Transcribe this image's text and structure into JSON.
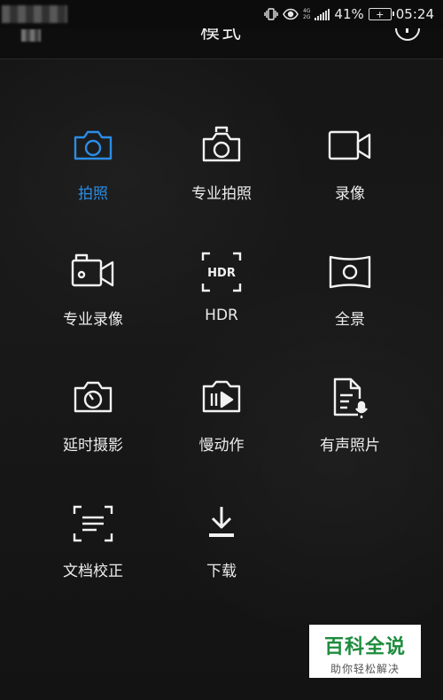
{
  "status_bar": {
    "network_top": "4G",
    "network_bottom": "2G",
    "battery_percent": "41%",
    "time": "05:24",
    "icons": [
      "vibrate-icon",
      "eye-icon",
      "signal-icon",
      "battery-charging-icon"
    ]
  },
  "header": {
    "title": "模式",
    "back_icon": "back-icon",
    "info_icon": "info-icon"
  },
  "modes": [
    {
      "label": "拍照",
      "icon": "camera-icon",
      "active": true
    },
    {
      "label": "专业拍照",
      "icon": "pro-camera-icon",
      "active": false
    },
    {
      "label": "录像",
      "icon": "video-icon",
      "active": false
    },
    {
      "label": "专业录像",
      "icon": "pro-video-icon",
      "active": false
    },
    {
      "label": "HDR",
      "icon": "hdr-icon",
      "active": false
    },
    {
      "label": "全景",
      "icon": "panorama-icon",
      "active": false
    },
    {
      "label": "延时摄影",
      "icon": "timelapse-icon",
      "active": false
    },
    {
      "label": "慢动作",
      "icon": "slow-motion-icon",
      "active": false
    },
    {
      "label": "有声照片",
      "icon": "audio-photo-icon",
      "active": false
    },
    {
      "label": "文档校正",
      "icon": "document-scan-icon",
      "active": false
    },
    {
      "label": "下载",
      "icon": "download-icon",
      "active": false
    }
  ],
  "colors": {
    "background": "#161616",
    "active_accent": "#2a8de6",
    "icon_default": "#f2f2f2"
  },
  "watermark": {
    "title": "百科全说",
    "subtitle": "助你轻松解决"
  }
}
